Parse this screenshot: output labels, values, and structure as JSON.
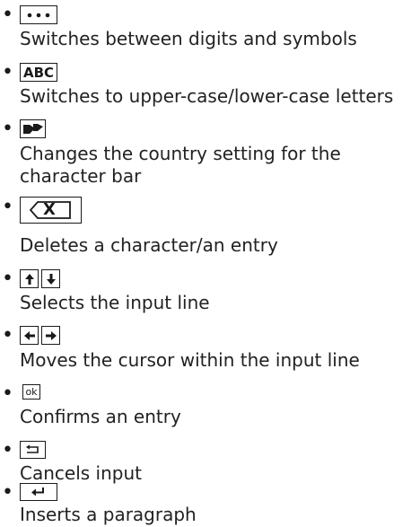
{
  "items": [
    {
      "key_name": "more-icon",
      "description": "Switches between digits and symbols"
    },
    {
      "key_label": "ABC",
      "description": "Switches to upper-case/lower-case letters"
    },
    {
      "key_name": "country-flags-icon",
      "description": "Changes the country setting for the character bar"
    },
    {
      "key_name": "backspace-icon",
      "key_label": "X",
      "description": "Deletes a character/an entry"
    },
    {
      "key_name": "arrow-up-down-icons",
      "description": "Selects the input line"
    },
    {
      "key_name": "arrow-left-right-icons",
      "description": "Moves the cursor within the input line"
    },
    {
      "key_label": "ok",
      "description": "Confirms an entry"
    },
    {
      "key_name": "back-icon",
      "description": "Cancels input"
    },
    {
      "key_name": "enter-icon",
      "description": "Inserts a paragraph"
    }
  ]
}
